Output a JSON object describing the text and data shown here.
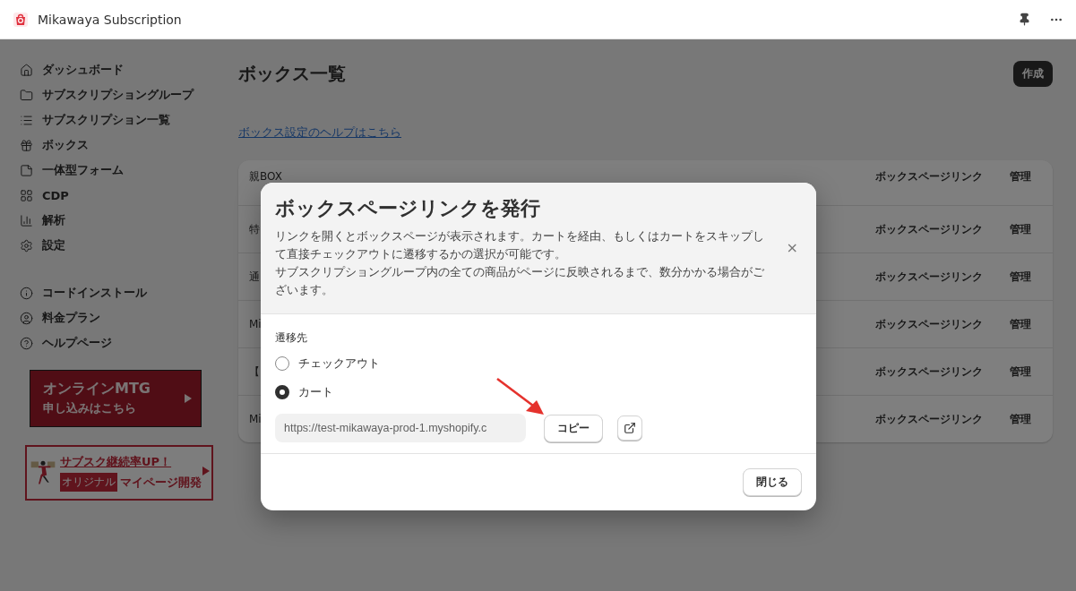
{
  "window": {
    "title": "Mikawaya Subscription"
  },
  "sidebar": {
    "items": [
      {
        "label": "ダッシュボード"
      },
      {
        "label": "サブスクリプショングループ"
      },
      {
        "label": "サブスクリプション一覧"
      },
      {
        "label": "ボックス"
      },
      {
        "label": "一体型フォーム"
      },
      {
        "label": "CDP"
      },
      {
        "label": "解析"
      },
      {
        "label": "設定"
      }
    ],
    "secondary_items": [
      {
        "label": "コードインストール"
      },
      {
        "label": "料金プラン"
      },
      {
        "label": "ヘルプページ"
      }
    ],
    "banners": [
      {
        "kind": "meeting",
        "lines": [
          "オンラインMTG",
          "申し込みはこちら"
        ]
      },
      {
        "kind": "mypage",
        "headline": "サブスク継続率UP！",
        "tag": "オリジナル",
        "text": "マイページ開発"
      }
    ]
  },
  "page": {
    "title": "ボックス一覧",
    "create_button": "作成",
    "help_link": "ボックス設定のヘルプはこちら",
    "rows": [
      {
        "name": "親BOX",
        "link": "ボックスページリンク",
        "manage": "管理"
      },
      {
        "name": "特",
        "link": "ボックスページリンク",
        "manage": "管理"
      },
      {
        "name": "通",
        "link": "ボックスページリンク",
        "manage": "管理"
      },
      {
        "name": "Mi",
        "link": "ボックスページリンク",
        "manage": "管理"
      },
      {
        "name": "【",
        "link": "ボックスページリンク",
        "manage": "管理"
      },
      {
        "name": "Mi",
        "link": "ボックスページリンク",
        "manage": "管理"
      }
    ]
  },
  "modal": {
    "title": "ボックスページリンクを発行",
    "description": [
      "リンクを開くとボックスページが表示されます。カートを経由、もしくはカートをスキップして直接チェックアウトに遷移するかの選択が可能です。",
      "サブスクリプショングループ内の全ての商品がページに反映されるまで、数分かかる場合がございます。"
    ],
    "close_icon": "×",
    "field_label": "遷移先",
    "options": [
      {
        "label": "チェックアウト",
        "selected": false
      },
      {
        "label": "カート",
        "selected": true
      }
    ],
    "url": "https://test-mikawaya-prod-1.myshopify.c",
    "copy_button": "コピー",
    "close_button": "閉じる"
  }
}
